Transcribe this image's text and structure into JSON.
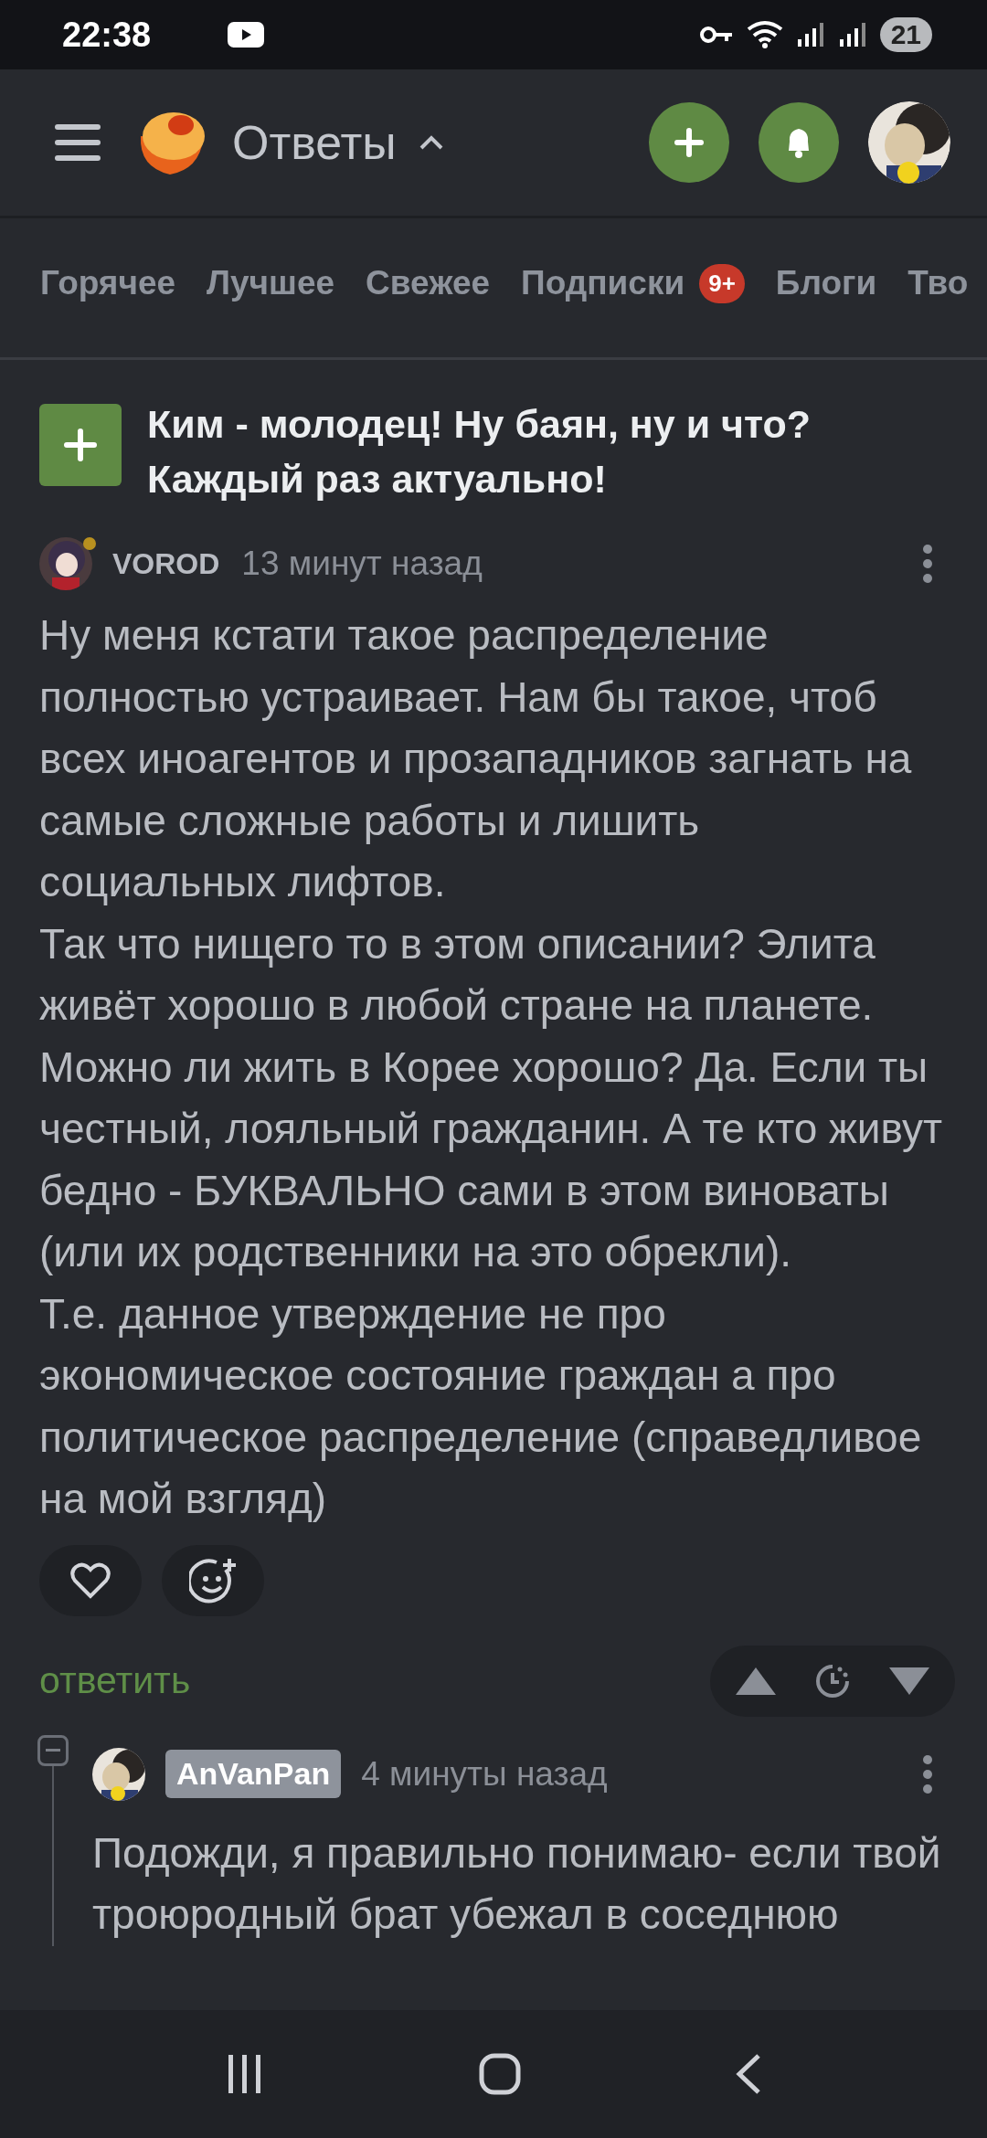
{
  "status_bar": {
    "time": "22:38",
    "battery": "21"
  },
  "header": {
    "title": "Ответы",
    "expanded": true
  },
  "tabs": [
    {
      "label": "Горячее",
      "selected": false
    },
    {
      "label": "Лучшее",
      "selected": false
    },
    {
      "label": "Свежее",
      "selected": false
    },
    {
      "label": "Подписки",
      "selected": false,
      "badge": "9+"
    },
    {
      "label": "Блоги",
      "selected": false
    },
    {
      "label": "Тво",
      "selected": false
    }
  ],
  "post": {
    "title": "Ким - молодец! Ну баян, ну и что? Каждый раз актуально!"
  },
  "comment": {
    "author": "VOROD",
    "online": true,
    "time": "13 минут назад",
    "paragraphs": [
      "Ну меня кстати такое распределение полностью устраивает. Нам бы такое, чтоб всех иноагентов и прозападников загнать на самые сложные работы и лишить социальных лифтов.",
      "Так что нищего то в этом описании? Элита живёт хорошо в любой стране на планете. Можно ли жить в Корее хорошо? Да. Если ты честный, лояльный гражданин. А те кто живут бедно - БУКВАЛЬНО сами в этом виноваты (или их родственники на это обрекли).",
      "Т.е. данное утверждение не про экономическое состояние граждан а про политическое распределение (справедливое на мой взгляд)"
    ],
    "reply_label": "ответить"
  },
  "reply": {
    "expanded": true,
    "author": "AnVanPan",
    "time": "4 минуты назад",
    "paragraphs": [
      "Подожди, я правильно понимаю- если твой троюродный брат убежал в соседнюю"
    ]
  }
}
